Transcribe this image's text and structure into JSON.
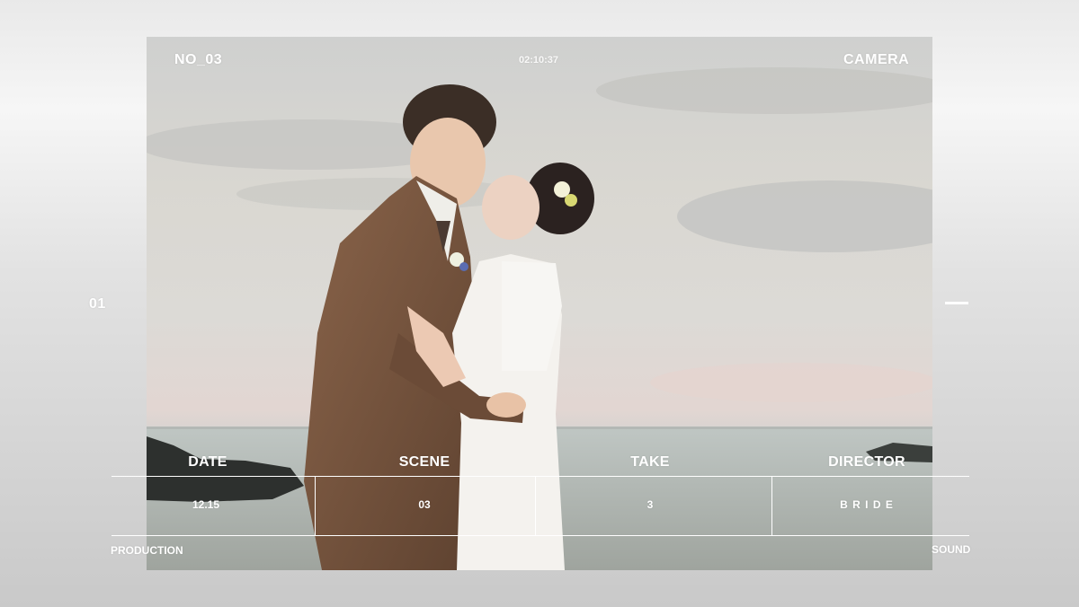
{
  "frame": {
    "number": "NO_03",
    "timecode": "02:10:37",
    "mode": "CAMERA",
    "side_index": "01",
    "production_label": "PRODUCTION",
    "sound_label": "SOUND"
  },
  "slate": {
    "columns": [
      {
        "header": "DATE",
        "value": "12.15"
      },
      {
        "header": "SCENE",
        "value": "03"
      },
      {
        "header": "TAKE",
        "value": "3"
      },
      {
        "header": "DIRECTOR",
        "value": "B R I D E"
      }
    ]
  }
}
